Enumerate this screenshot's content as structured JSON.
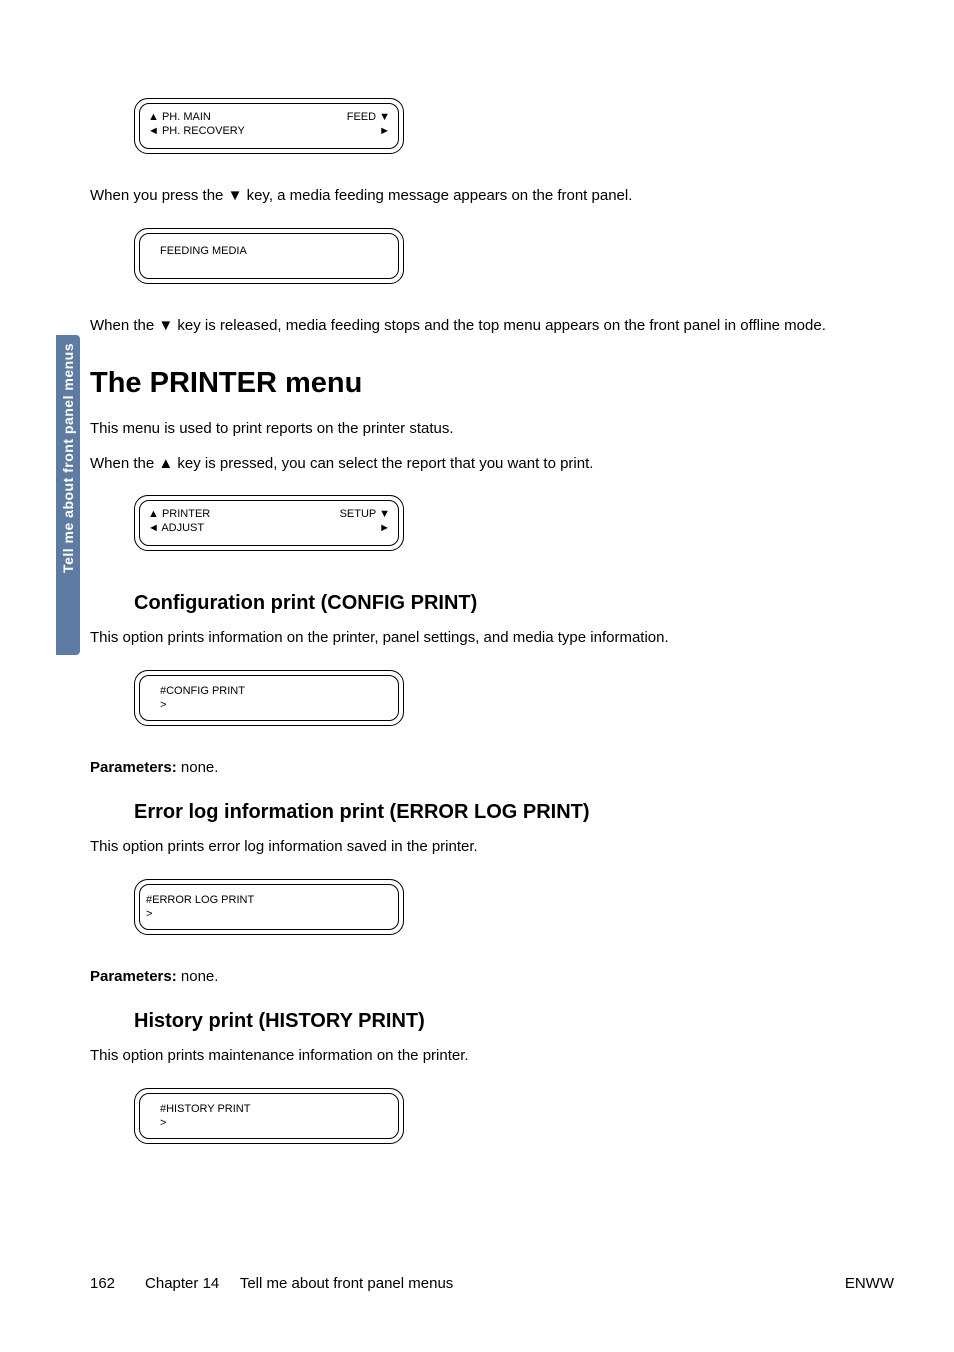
{
  "sidetab": "Tell me about front panel menus",
  "lcd1": {
    "row1_left": "▲ PH. MAIN",
    "row1_right": "FEED  ▼",
    "row2_left": "◄ PH. RECOVERY",
    "row2_right": "►"
  },
  "para1": "When you press the ▼ key, a media feeding message appears on the front panel.",
  "lcd2": {
    "line1": "FEEDING MEDIA"
  },
  "para2": "When the ▼ key is released, media feeding stops and the top menu appears on the front panel in offline mode.",
  "h1": "The PRINTER menu",
  "para3": "This menu is used to print reports on the printer status.",
  "para4": "When the ▲ key is pressed, you can select the report that you want to print.",
  "lcd3": {
    "row1_left": "▲ PRINTER",
    "row1_right": "SETUP ▼",
    "row2_left": "◄ ADJUST",
    "row2_right": "►"
  },
  "h2a": "Configuration print (CONFIG PRINT)",
  "para5": "This option prints information on the printer, panel settings, and media type information.",
  "lcd4": {
    "line1": "#CONFIG PRINT",
    "line2": ">"
  },
  "param_label": "Parameters:",
  "param_none": " none.",
  "h2b": "Error log information print (ERROR LOG PRINT)",
  "para6": "This option prints error log information saved in the printer.",
  "lcd5": {
    "line1": "#ERROR LOG PRINT",
    "line2": ">"
  },
  "h2c": "History print (HISTORY PRINT)",
  "para7": "This option prints maintenance information on the printer.",
  "lcd6": {
    "line1": "#HISTORY PRINT",
    "line2": ">"
  },
  "footer": {
    "page": "162",
    "chapter_label": "Chapter 14",
    "chapter_title": "Tell me about front panel menus",
    "right": "ENWW"
  }
}
